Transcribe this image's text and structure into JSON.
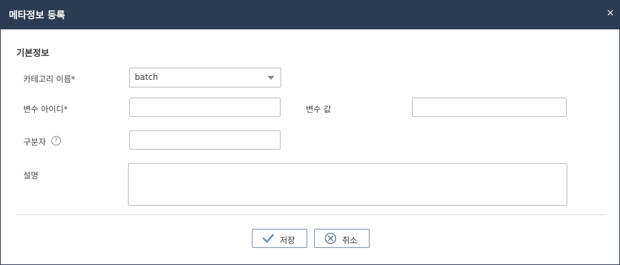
{
  "dialog": {
    "title": "메타정보 등록",
    "close_label": "×"
  },
  "section": {
    "title": "기본정보"
  },
  "form": {
    "category_label": "카테고리 이름*",
    "category_value": "batch",
    "variable_id_label": "변수 아이디*",
    "variable_id_value": "",
    "variable_value_label": "변수 값",
    "variable_value_value": "",
    "delimiter_label": "구분자",
    "delimiter_help": "?",
    "delimiter_value": "",
    "description_label": "설명",
    "description_value": ""
  },
  "buttons": {
    "save_label": "저장",
    "cancel_label": "취소"
  },
  "colors": {
    "titlebar": "#2b3b51",
    "accent_icon": "#5b8fc9",
    "cancel_icon": "#6d7f96"
  },
  "icons": {
    "close": "close-icon",
    "dropdown": "chevron-down-icon",
    "help": "help-icon",
    "save": "check-icon",
    "cancel": "cancel-circle-icon"
  }
}
